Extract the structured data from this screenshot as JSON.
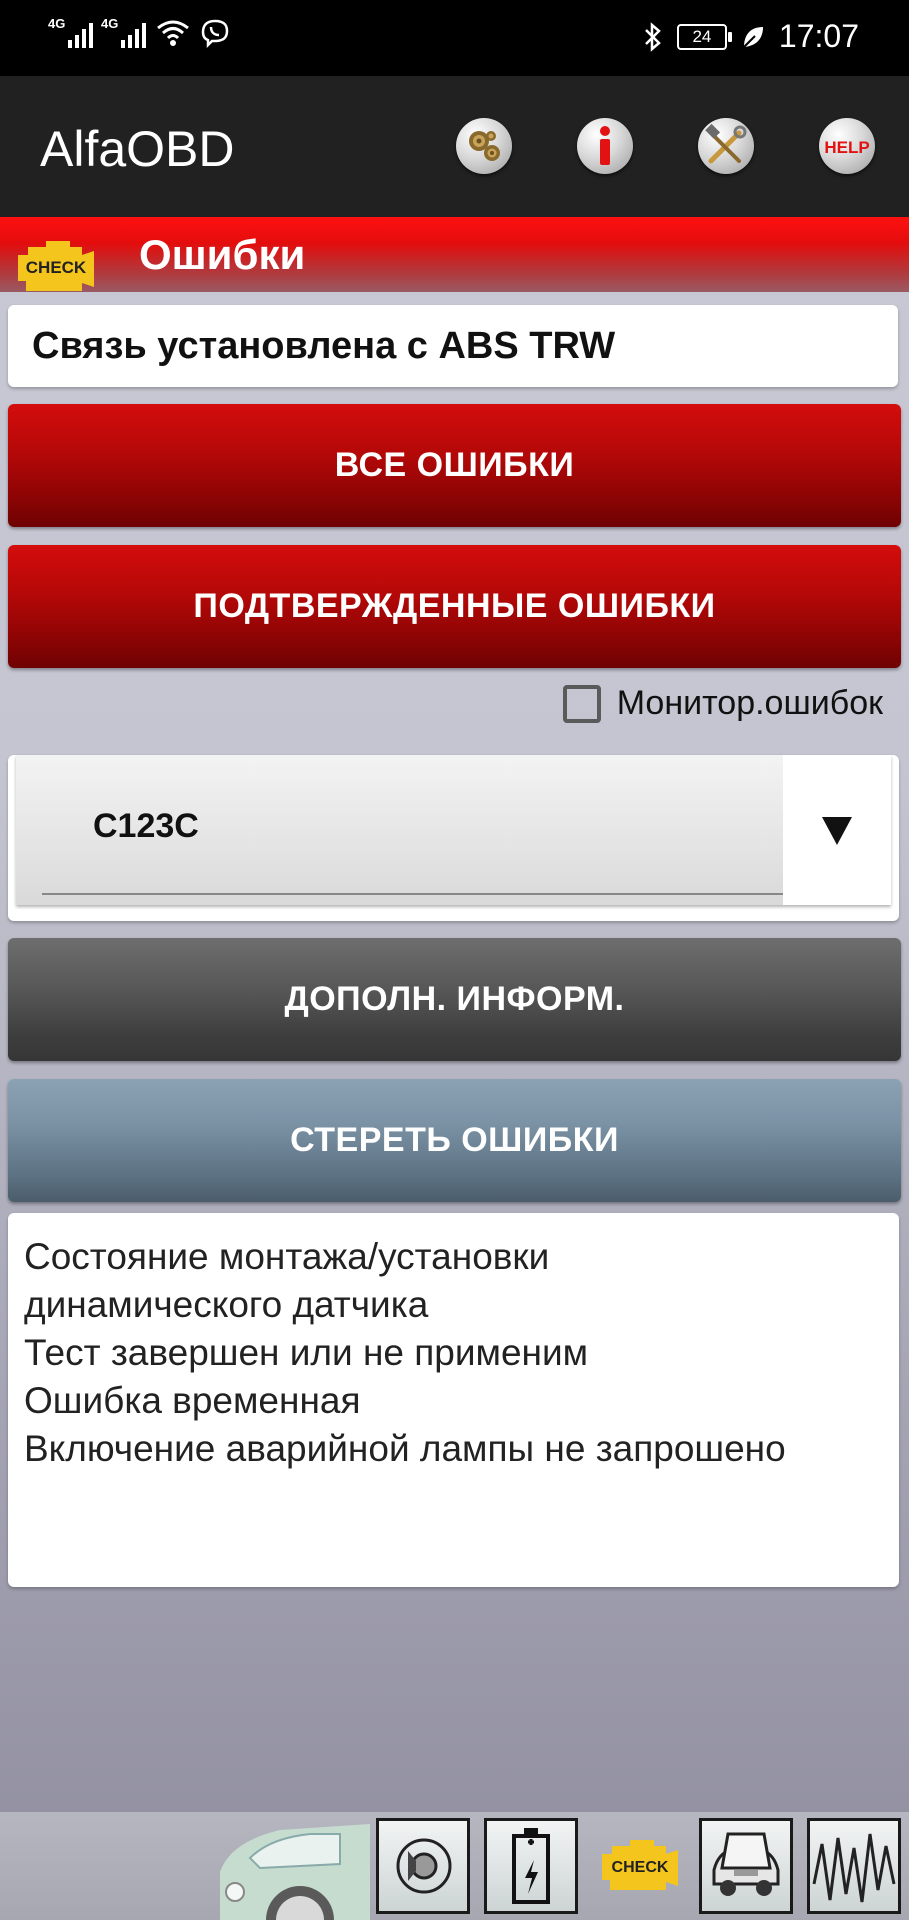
{
  "status_bar": {
    "network_1": "4G",
    "network_2": "4G",
    "battery_level": "24",
    "time": "17:07",
    "icons": [
      "signal-icon",
      "signal-icon",
      "wifi-icon",
      "viber-icon",
      "bluetooth-icon",
      "battery-icon",
      "leaf-icon"
    ]
  },
  "app_bar": {
    "title": "AlfaOBD",
    "help_label": "HELP",
    "icons": [
      "gears-icon",
      "info-icon",
      "tools-icon",
      "help-icon"
    ]
  },
  "section": {
    "badge_label": "CHECK",
    "title": "Ошибки"
  },
  "main": {
    "connection_status": "Связь установлена с ABS TRW",
    "all_errors_button": "ВСЕ ОШИБКИ",
    "confirmed_errors_button": "ПОДТВЕРЖДЕННЫЕ ОШИБКИ",
    "monitor_label": "Монитор.ошибок",
    "monitor_checked": false,
    "selected_code": "C123C",
    "more_info_button": "ДОПОЛН. ИНФОРМ.",
    "clear_errors_button": "СТЕРЕТЬ ОШИБКИ",
    "details": [
      "Состояние монтажа/установки",
      "динамического датчика",
      "Тест завершен или не применим",
      "Ошибка временная",
      "Включение аварийной лампы не запрошено"
    ]
  },
  "bottom_nav": {
    "check_label": "CHECK",
    "icons": [
      "car-icon",
      "speaker-icon",
      "battery-icon",
      "check-engine-icon",
      "car-hood-icon",
      "waveform-icon"
    ]
  },
  "colors": {
    "red_button": "#b50808",
    "gray_button": "#555555",
    "steel_button": "#7c93a6",
    "header_red": "#e30d0d",
    "app_bar": "#212121",
    "check_yellow": "#f4c51c"
  }
}
